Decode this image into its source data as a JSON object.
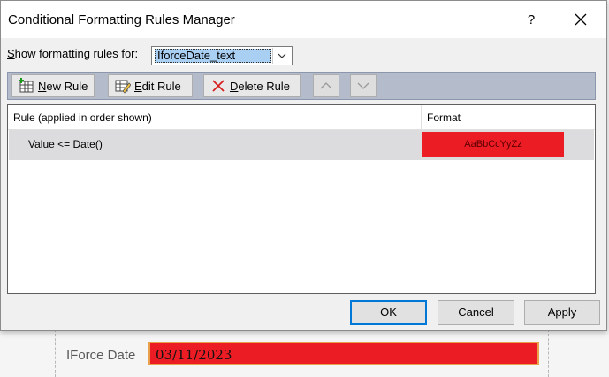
{
  "background": {
    "field_label": "IForce Date",
    "field_value": "03/11/2023"
  },
  "dialog": {
    "title": "Conditional Formatting Rules Manager",
    "help": "?",
    "show_rules_for": {
      "label_prefix": "S",
      "label_rest": "how formatting rules for:",
      "selected": "IforceDate_text"
    },
    "toolbar": {
      "new_rule_u": "N",
      "new_rule_rest": "ew Rule",
      "edit_rule_u": "E",
      "edit_rule_rest": "dit Rule",
      "delete_rule_u": "D",
      "delete_rule_rest": "elete Rule"
    },
    "grid": {
      "col_rule": "Rule (applied in order shown)",
      "col_format": "Format",
      "rows": [
        {
          "rule": "Value <= Date()",
          "format_preview": "AaBbCcYyZz",
          "format_color": "#ec1c24"
        }
      ]
    },
    "buttons": {
      "ok": "OK",
      "cancel": "Cancel",
      "apply": "Apply"
    }
  },
  "colors": {
    "highlight_red": "#ec1c24",
    "selection_blue": "#a9cff3",
    "toolbar_bg": "#b4bccc"
  },
  "icons": [
    "new-rule-icon",
    "edit-rule-icon",
    "delete-x-icon",
    "move-up-icon",
    "move-down-icon",
    "close-icon",
    "combo-dropdown-icon"
  ]
}
